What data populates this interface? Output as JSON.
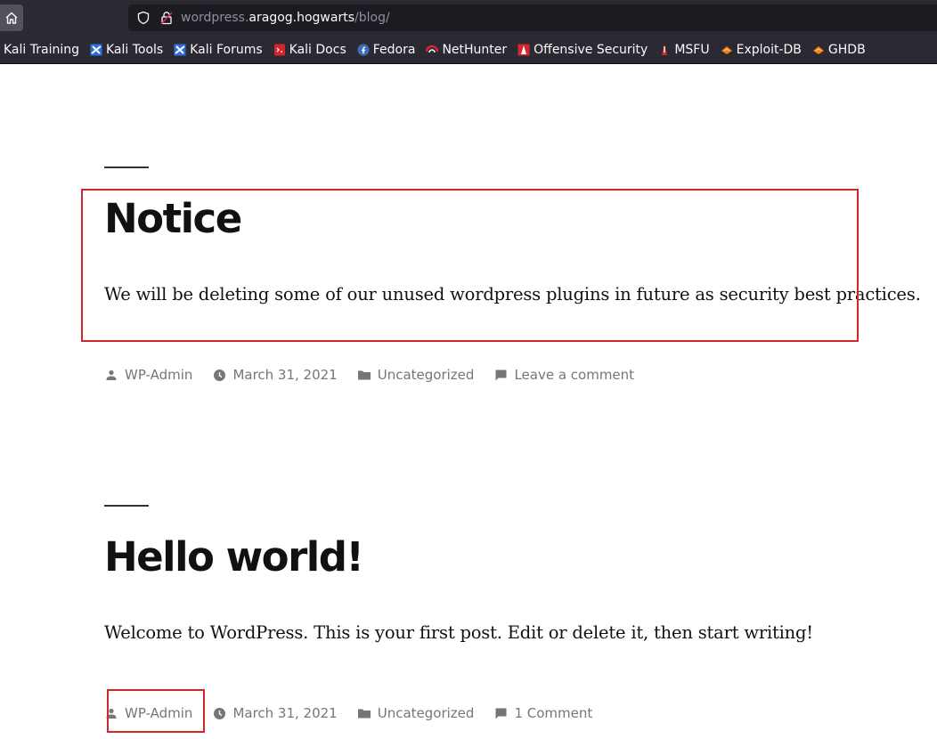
{
  "browser": {
    "url_prefix": "wordpress.",
    "url_host": "aragog.hogwarts",
    "url_path": "/blog/",
    "bookmarks": [
      {
        "label": "Kali Training"
      },
      {
        "label": "Kali Tools"
      },
      {
        "label": "Kali Forums"
      },
      {
        "label": "Kali Docs"
      },
      {
        "label": "Fedora"
      },
      {
        "label": "NetHunter"
      },
      {
        "label": "Offensive Security"
      },
      {
        "label": "MSFU"
      },
      {
        "label": "Exploit-DB"
      },
      {
        "label": "GHDB"
      }
    ]
  },
  "posts": [
    {
      "title": "Notice",
      "body": "We will be deleting some of our unused wordpress plugins in future as security best practices.",
      "author": "WP-Admin",
      "date": "March 31, 2021",
      "category": "Uncategorized",
      "comments": "Leave a comment"
    },
    {
      "title": "Hello world!",
      "body": "Welcome to WordPress. This is your first post. Edit or delete it, then start writing!",
      "author": "WP-Admin",
      "date": "March 31, 2021",
      "category": "Uncategorized",
      "comments": "1 Comment"
    }
  ],
  "colors": {
    "highlight": "#d02828",
    "meta_text": "#767676"
  }
}
